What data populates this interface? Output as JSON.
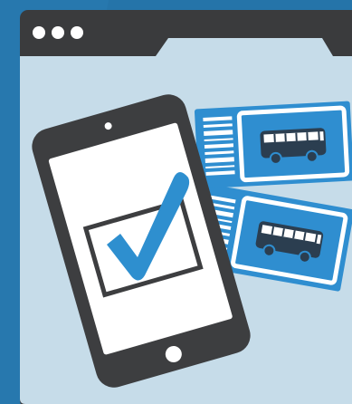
{
  "colors": {
    "background": "#2574a9",
    "window_frame": "#3a3b3d",
    "window_dots": "#ffffff",
    "window_body": "#c6dce9",
    "phone_body": "#3d3e40",
    "phone_screen": "#ffffff",
    "check_box_border": "#3d3e40",
    "check_mark": "#2e8fcf",
    "ticket_fill": "#2f8ed0",
    "ticket_light": "#ffffff",
    "bus_color": "#2b3e50"
  },
  "icons": {
    "window_controls": "three-dot-icon",
    "status": "check-mark-icon",
    "ticket_top": "bus-icon",
    "ticket_bottom": "bus-icon"
  }
}
